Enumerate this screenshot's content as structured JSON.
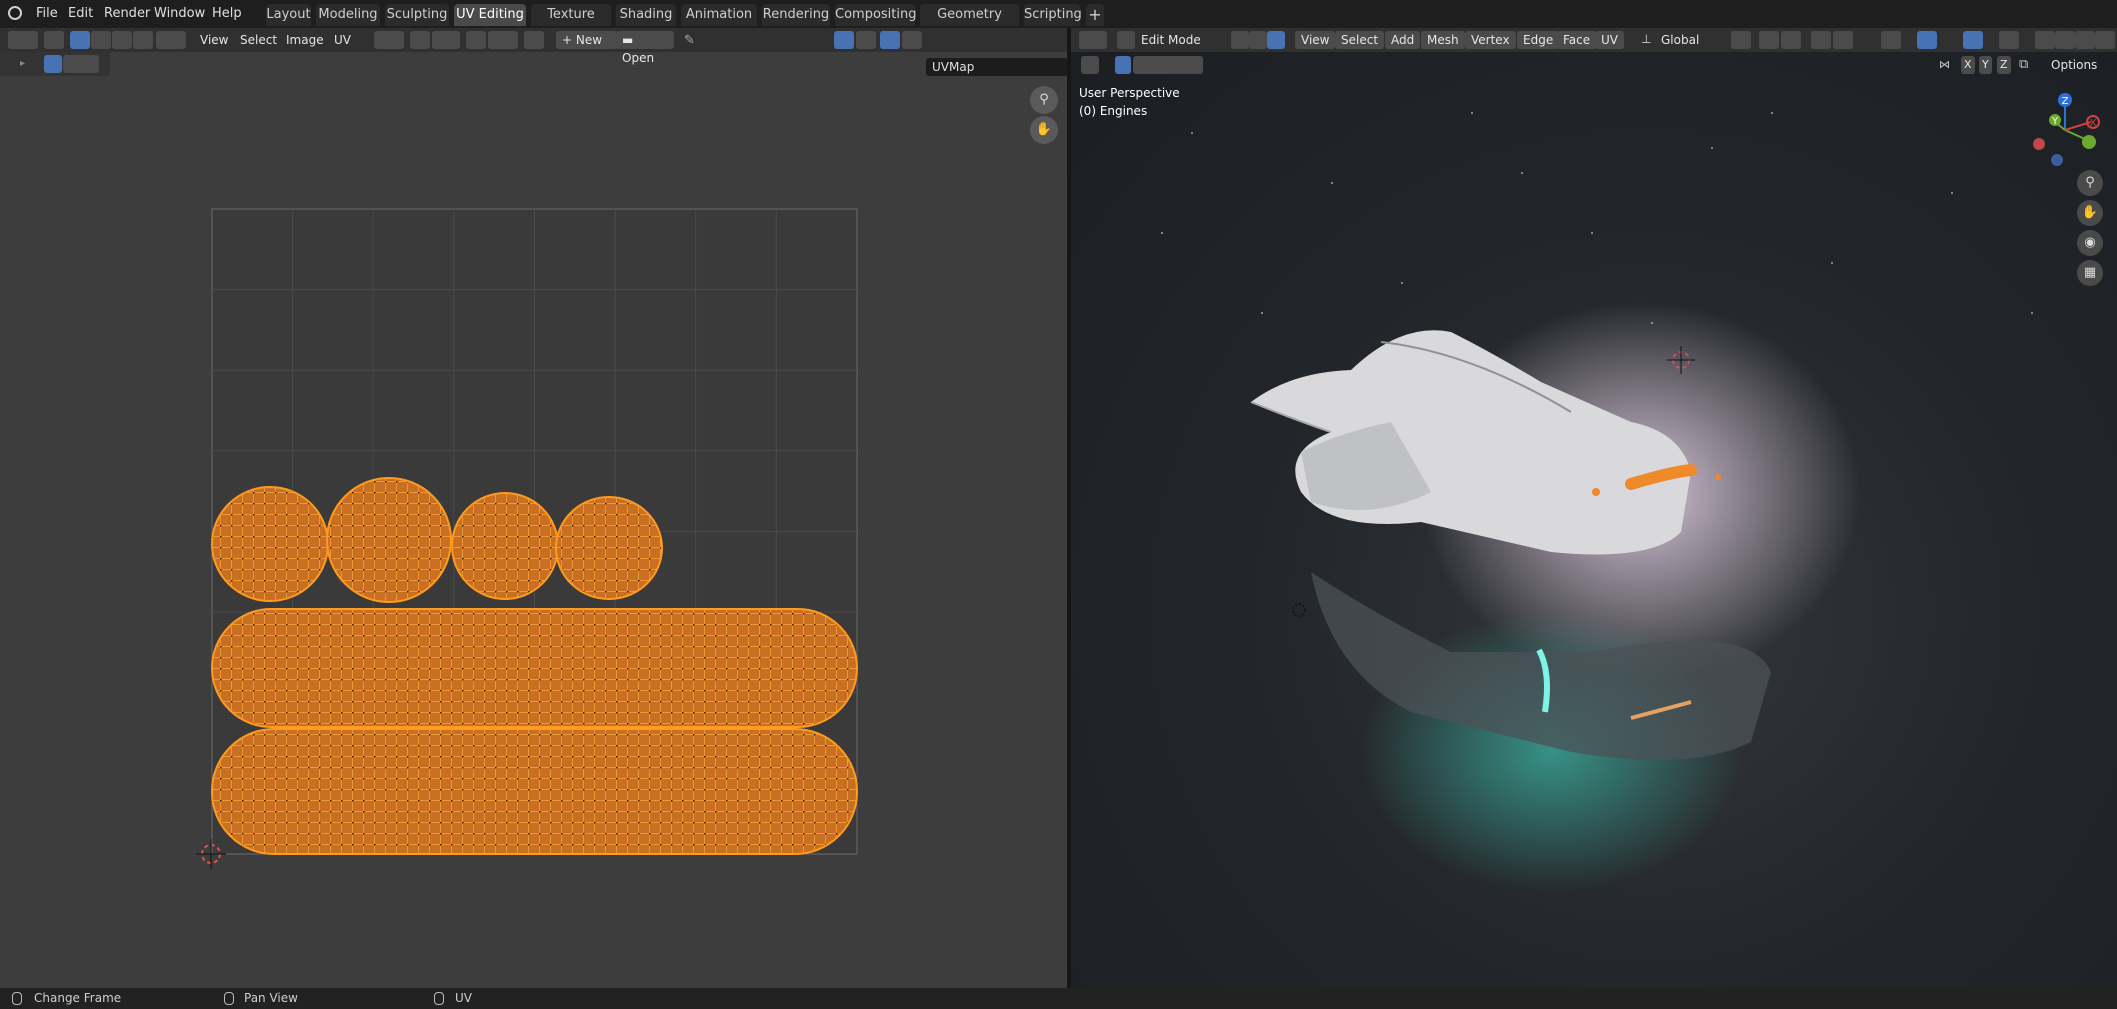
{
  "menu": [
    "File",
    "Edit",
    "Render",
    "Window",
    "Help"
  ],
  "workspaces": [
    {
      "label": "Layout",
      "active": false
    },
    {
      "label": "Modeling",
      "active": false
    },
    {
      "label": "Sculpting",
      "active": false
    },
    {
      "label": "UV Editing",
      "active": true
    },
    {
      "label": "Texture Paint",
      "active": false
    },
    {
      "label": "Shading",
      "active": false
    },
    {
      "label": "Animation",
      "active": false
    },
    {
      "label": "Rendering",
      "active": false
    },
    {
      "label": "Compositing",
      "active": false
    },
    {
      "label": "Geometry Nodes",
      "active": false
    },
    {
      "label": "Scripting",
      "active": false
    }
  ],
  "add_workspace_icon": "plus-icon",
  "uv_editor": {
    "menus": [
      "View",
      "Select",
      "Image",
      "UV"
    ],
    "new_label": "New",
    "open_label": "Open",
    "uvmap_value": "UVMap",
    "island_color": "#d27d2c",
    "edge_color": "#ff9a1f"
  },
  "viewport": {
    "mode_label": "Edit Mode",
    "menus": [
      "View",
      "Select",
      "Add",
      "Mesh",
      "Vertex",
      "Edge",
      "Face",
      "UV"
    ],
    "transform_orientation": "Global",
    "overlay_title": "User Perspective",
    "overlay_object": "(0) Engines",
    "axis_labels": [
      "X",
      "Y",
      "Z"
    ],
    "options_label": "Options",
    "gizmo": {
      "x": "X",
      "y": "Y",
      "z": "Z"
    }
  },
  "statusbar": {
    "left": "Change Frame",
    "middle": "Pan View",
    "right": "UV"
  }
}
